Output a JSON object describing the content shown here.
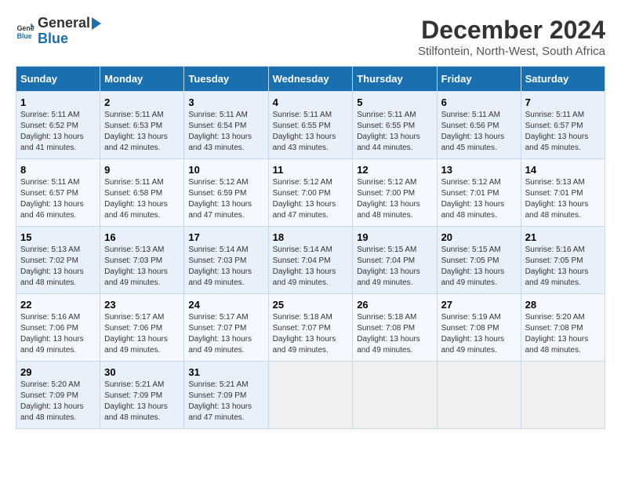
{
  "logo": {
    "general": "General",
    "blue": "Blue"
  },
  "title": "December 2024",
  "subtitle": "Stilfontein, North-West, South Africa",
  "weekdays": [
    "Sunday",
    "Monday",
    "Tuesday",
    "Wednesday",
    "Thursday",
    "Friday",
    "Saturday"
  ],
  "weeks": [
    [
      {
        "day": "1",
        "sunrise": "5:11 AM",
        "sunset": "6:52 PM",
        "daylight": "13 hours and 41 minutes."
      },
      {
        "day": "2",
        "sunrise": "5:11 AM",
        "sunset": "6:53 PM",
        "daylight": "13 hours and 42 minutes."
      },
      {
        "day": "3",
        "sunrise": "5:11 AM",
        "sunset": "6:54 PM",
        "daylight": "13 hours and 43 minutes."
      },
      {
        "day": "4",
        "sunrise": "5:11 AM",
        "sunset": "6:55 PM",
        "daylight": "13 hours and 43 minutes."
      },
      {
        "day": "5",
        "sunrise": "5:11 AM",
        "sunset": "6:55 PM",
        "daylight": "13 hours and 44 minutes."
      },
      {
        "day": "6",
        "sunrise": "5:11 AM",
        "sunset": "6:56 PM",
        "daylight": "13 hours and 45 minutes."
      },
      {
        "day": "7",
        "sunrise": "5:11 AM",
        "sunset": "6:57 PM",
        "daylight": "13 hours and 45 minutes."
      }
    ],
    [
      {
        "day": "8",
        "sunrise": "5:11 AM",
        "sunset": "6:57 PM",
        "daylight": "13 hours and 46 minutes."
      },
      {
        "day": "9",
        "sunrise": "5:11 AM",
        "sunset": "6:58 PM",
        "daylight": "13 hours and 46 minutes."
      },
      {
        "day": "10",
        "sunrise": "5:12 AM",
        "sunset": "6:59 PM",
        "daylight": "13 hours and 47 minutes."
      },
      {
        "day": "11",
        "sunrise": "5:12 AM",
        "sunset": "7:00 PM",
        "daylight": "13 hours and 47 minutes."
      },
      {
        "day": "12",
        "sunrise": "5:12 AM",
        "sunset": "7:00 PM",
        "daylight": "13 hours and 48 minutes."
      },
      {
        "day": "13",
        "sunrise": "5:12 AM",
        "sunset": "7:01 PM",
        "daylight": "13 hours and 48 minutes."
      },
      {
        "day": "14",
        "sunrise": "5:13 AM",
        "sunset": "7:01 PM",
        "daylight": "13 hours and 48 minutes."
      }
    ],
    [
      {
        "day": "15",
        "sunrise": "5:13 AM",
        "sunset": "7:02 PM",
        "daylight": "13 hours and 48 minutes."
      },
      {
        "day": "16",
        "sunrise": "5:13 AM",
        "sunset": "7:03 PM",
        "daylight": "13 hours and 49 minutes."
      },
      {
        "day": "17",
        "sunrise": "5:14 AM",
        "sunset": "7:03 PM",
        "daylight": "13 hours and 49 minutes."
      },
      {
        "day": "18",
        "sunrise": "5:14 AM",
        "sunset": "7:04 PM",
        "daylight": "13 hours and 49 minutes."
      },
      {
        "day": "19",
        "sunrise": "5:15 AM",
        "sunset": "7:04 PM",
        "daylight": "13 hours and 49 minutes."
      },
      {
        "day": "20",
        "sunrise": "5:15 AM",
        "sunset": "7:05 PM",
        "daylight": "13 hours and 49 minutes."
      },
      {
        "day": "21",
        "sunrise": "5:16 AM",
        "sunset": "7:05 PM",
        "daylight": "13 hours and 49 minutes."
      }
    ],
    [
      {
        "day": "22",
        "sunrise": "5:16 AM",
        "sunset": "7:06 PM",
        "daylight": "13 hours and 49 minutes."
      },
      {
        "day": "23",
        "sunrise": "5:17 AM",
        "sunset": "7:06 PM",
        "daylight": "13 hours and 49 minutes."
      },
      {
        "day": "24",
        "sunrise": "5:17 AM",
        "sunset": "7:07 PM",
        "daylight": "13 hours and 49 minutes."
      },
      {
        "day": "25",
        "sunrise": "5:18 AM",
        "sunset": "7:07 PM",
        "daylight": "13 hours and 49 minutes."
      },
      {
        "day": "26",
        "sunrise": "5:18 AM",
        "sunset": "7:08 PM",
        "daylight": "13 hours and 49 minutes."
      },
      {
        "day": "27",
        "sunrise": "5:19 AM",
        "sunset": "7:08 PM",
        "daylight": "13 hours and 49 minutes."
      },
      {
        "day": "28",
        "sunrise": "5:20 AM",
        "sunset": "7:08 PM",
        "daylight": "13 hours and 48 minutes."
      }
    ],
    [
      {
        "day": "29",
        "sunrise": "5:20 AM",
        "sunset": "7:09 PM",
        "daylight": "13 hours and 48 minutes."
      },
      {
        "day": "30",
        "sunrise": "5:21 AM",
        "sunset": "7:09 PM",
        "daylight": "13 hours and 48 minutes."
      },
      {
        "day": "31",
        "sunrise": "5:21 AM",
        "sunset": "7:09 PM",
        "daylight": "13 hours and 47 minutes."
      },
      null,
      null,
      null,
      null
    ]
  ]
}
